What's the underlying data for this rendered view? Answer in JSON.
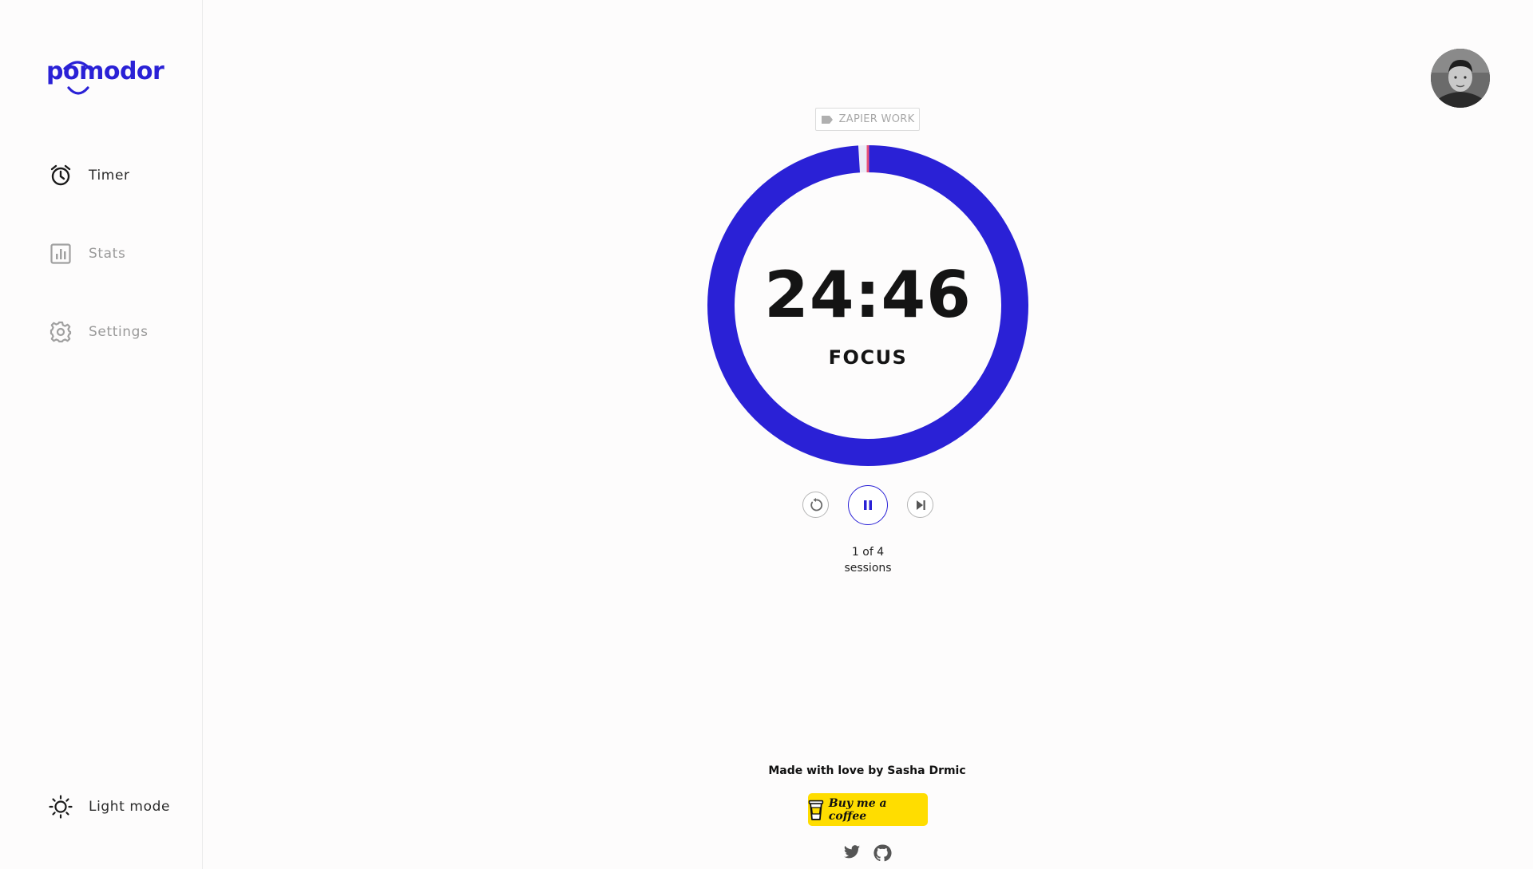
{
  "app": {
    "logo_text": "pomodor",
    "brand_color": "#2a21d6",
    "accent_marker_color": "#e8527a"
  },
  "sidebar": {
    "items": [
      {
        "label": "Timer",
        "icon": "alarm-clock-icon",
        "active": true
      },
      {
        "label": "Stats",
        "icon": "bar-chart-icon",
        "active": false
      },
      {
        "label": "Settings",
        "icon": "gear-icon",
        "active": false
      }
    ],
    "theme_toggle": {
      "label": "Light mode",
      "icon": "sun-icon"
    }
  },
  "header": {
    "avatar": "user-avatar"
  },
  "timer": {
    "label_tag": "ZAPIER WORK",
    "tag_icon": "tag-icon",
    "time": "24:46",
    "mode": "FOCUS",
    "progress_fraction": 0.99,
    "session_line1": "1 of 4",
    "session_line2": "sessions",
    "controls": [
      "restart-icon",
      "pause-icon",
      "skip-icon"
    ]
  },
  "footer": {
    "made_by": "Made with love by Sasha Drmic",
    "coffee_label": "Buy me a coffee",
    "coffee_color": "#ffdd00",
    "social": [
      "twitter-icon",
      "github-icon"
    ]
  }
}
